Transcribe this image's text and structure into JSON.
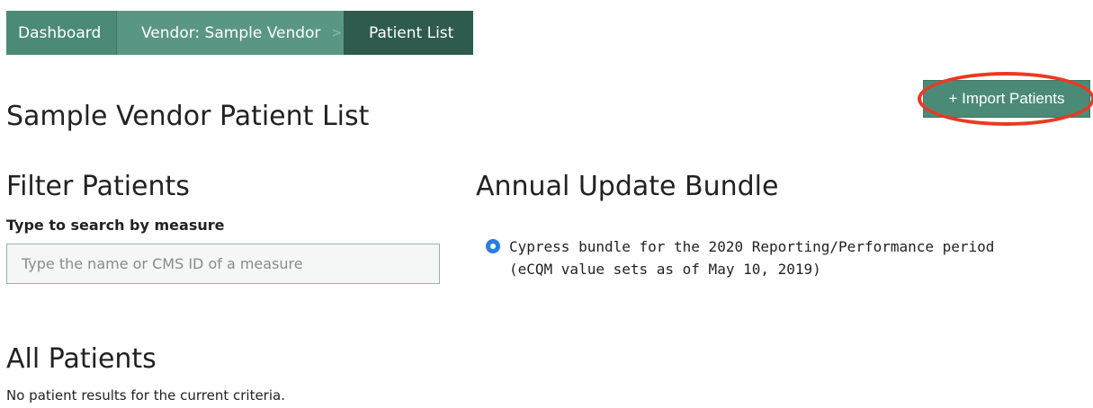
{
  "breadcrumb": {
    "items": [
      {
        "label": "Dashboard"
      },
      {
        "label": "Vendor: Sample Vendor"
      },
      {
        "label": "Patient List"
      }
    ],
    "separator": ">"
  },
  "header": {
    "title": "Sample Vendor Patient List",
    "import_button_label": "+ Import Patients"
  },
  "filter": {
    "heading": "Filter Patients",
    "search_label": "Type to search by measure",
    "search_placeholder": "Type the name or CMS ID of a measure",
    "search_value": ""
  },
  "bundle": {
    "heading": "Annual Update Bundle",
    "options": [
      {
        "line1": "Cypress bundle for the 2020 Reporting/Performance period",
        "line2": "(eCQM value sets as of May 10, 2019)",
        "selected": true
      }
    ]
  },
  "patients": {
    "heading": "All Patients",
    "empty_message": "No patient results for the current criteria."
  },
  "colors": {
    "brand": "#4c8a78",
    "brand_dark": "#2f5b4f",
    "radio": "#2a7de1",
    "highlight": "#ea3a22"
  }
}
